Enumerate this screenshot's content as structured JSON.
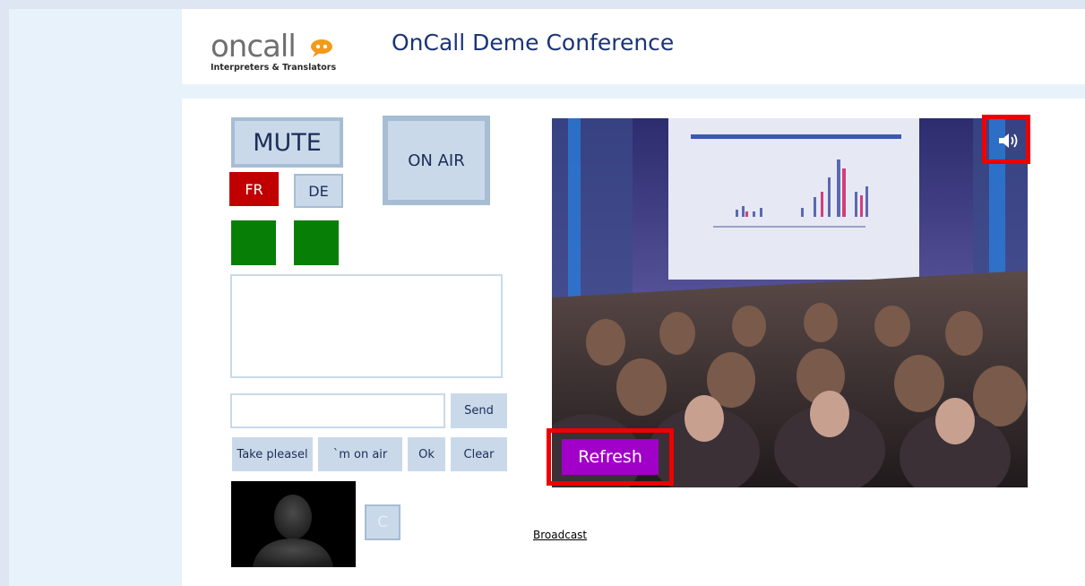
{
  "header": {
    "logo_word": "oncall",
    "logo_tagline": "Interpreters & Translators",
    "title": "OnCall Deme Conference"
  },
  "controls": {
    "mute_label": "MUTE",
    "on_air_label": "ON AIR",
    "languages": [
      {
        "label": "FR",
        "active": true
      },
      {
        "label": "DE",
        "active": false
      }
    ],
    "indicator_color": "#077f07"
  },
  "chat": {
    "input_value": "",
    "send_label": "Send",
    "quick_replies": [
      "Take pleasel",
      "`m on air",
      "Ok",
      "Clear"
    ]
  },
  "video": {
    "refresh_label": "Refresh",
    "sound_icon": "speaker-icon"
  },
  "misc": {
    "c_button_label": "C",
    "broadcast_link": "Broadcast"
  },
  "colors": {
    "accent_blue": "#1a3478",
    "button_bg": "#c9d9ea",
    "fr_active": "#c00000",
    "refresh": "#a000c8",
    "highlight_frame": "#ee0000"
  }
}
